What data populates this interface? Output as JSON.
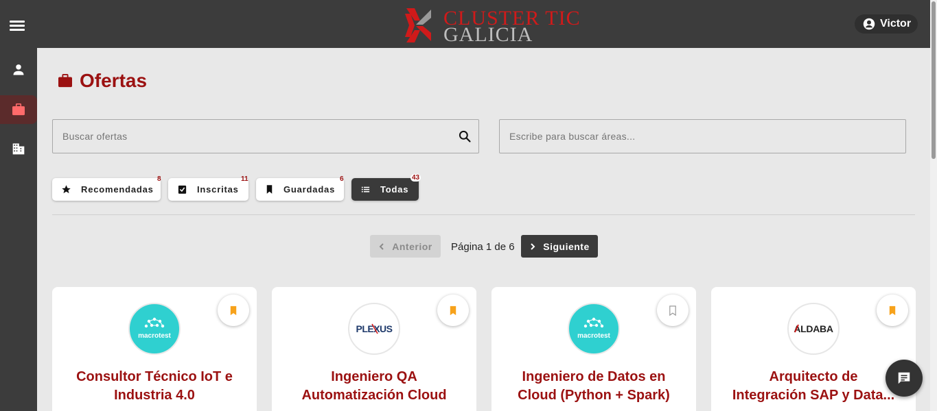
{
  "header": {
    "logo_line1": "CLUSTER TIC",
    "logo_line2": "GALICIA",
    "user_name": "Victor"
  },
  "sidebar": {
    "items": [
      {
        "icon": "person-icon"
      },
      {
        "icon": "briefcase-icon",
        "active": true
      },
      {
        "icon": "building-icon"
      }
    ]
  },
  "page": {
    "title": "Ofertas"
  },
  "search": {
    "offers_placeholder": "Buscar ofertas",
    "areas_placeholder": "Escribe para buscar áreas..."
  },
  "filters": [
    {
      "label": "Recomendadas",
      "count": "8",
      "icon": "star-icon"
    },
    {
      "label": "Inscritas",
      "count": "11",
      "icon": "checked-clipboard-icon"
    },
    {
      "label": "Guardadas",
      "count": "6",
      "icon": "bookmark-icon"
    },
    {
      "label": "Todas",
      "count": "43",
      "icon": "list-icon",
      "selected": true
    }
  ],
  "pagination": {
    "prev_label": "Anterior",
    "info": "Página 1 de 6",
    "next_label": "Siguiente"
  },
  "offers": [
    {
      "company_logo": "macrotest",
      "title_line1": "Consultor Técnico IoT e",
      "title_line2": "Industria 4.0",
      "saved": true
    },
    {
      "company_logo": "PLEXUS",
      "title_line1": "Ingeniero QA",
      "title_line2": "Automatización Cloud",
      "saved": true
    },
    {
      "company_logo": "macrotest",
      "title_line1": "Ingeniero de Datos en",
      "title_line2": "Cloud (Python + Spark)",
      "saved": false
    },
    {
      "company_logo": "ALDABA",
      "title_line1": "Arquitecto de",
      "title_line2": "Integración SAP y Data...",
      "saved": true
    }
  ],
  "colors": {
    "brand_red": "#9b1111",
    "bookmark_orange": "#f7a21b",
    "topbar": "#3c3c3c",
    "teal_logo": "#2fd0d0"
  }
}
